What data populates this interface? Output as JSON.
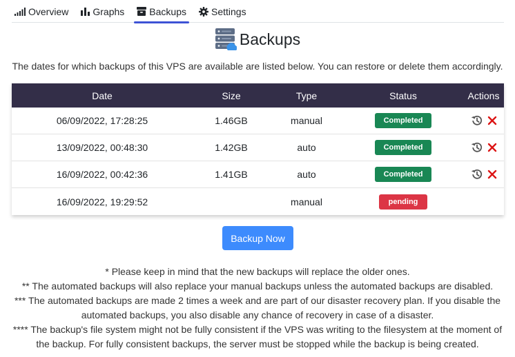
{
  "tabs": [
    {
      "label": "Overview",
      "icon": "signal-icon"
    },
    {
      "label": "Graphs",
      "icon": "bar-chart-icon"
    },
    {
      "label": "Backups",
      "icon": "archive-box-icon",
      "active": true
    },
    {
      "label": "Settings",
      "icon": "gear-icon"
    }
  ],
  "page": {
    "title": "Backups",
    "icon": "server-icon",
    "intro": "The dates for which backups of this VPS are available are listed below. You can restore or delete them accordingly."
  },
  "table": {
    "headers": {
      "date": "Date",
      "size": "Size",
      "type": "Type",
      "status": "Status",
      "actions": "Actions"
    },
    "rows": [
      {
        "date": "06/09/2022, 17:28:25",
        "size": "1.46GB",
        "type": "manual",
        "status": "Completed"
      },
      {
        "date": "13/09/2022, 00:48:30",
        "size": "1.42GB",
        "type": "auto",
        "status": "Completed"
      },
      {
        "date": "16/09/2022, 00:42:36",
        "size": "1.41GB",
        "type": "auto",
        "status": "Completed"
      },
      {
        "date": "16/09/2022, 19:29:52",
        "size": "",
        "type": "manual",
        "status": "pending"
      }
    ]
  },
  "actions": {
    "backup_now": "Backup Now"
  },
  "notes": [
    "* Please keep in mind that the new backups will replace the older ones.",
    "** The automated backups will also replace your manual backups unless the automated backups are disabled.",
    "*** The automated backups are made 2 times a week and are part of our disaster recovery plan. If you disable the automated backups, you also disable any chance of recovery in case of a disaster.",
    "**** The backup's file system might not be fully consistent if the VPS was writing to the filesystem at the moment of the backup. For fully consistent backups, the server must be stopped while the backup is being created."
  ],
  "colors": {
    "header_bg": "#332e48",
    "active_tab": "#3d52d5",
    "completed": "#198754",
    "pending": "#dc3545",
    "primary_button": "#3d8bfd",
    "delete_icon": "#dc1414"
  }
}
